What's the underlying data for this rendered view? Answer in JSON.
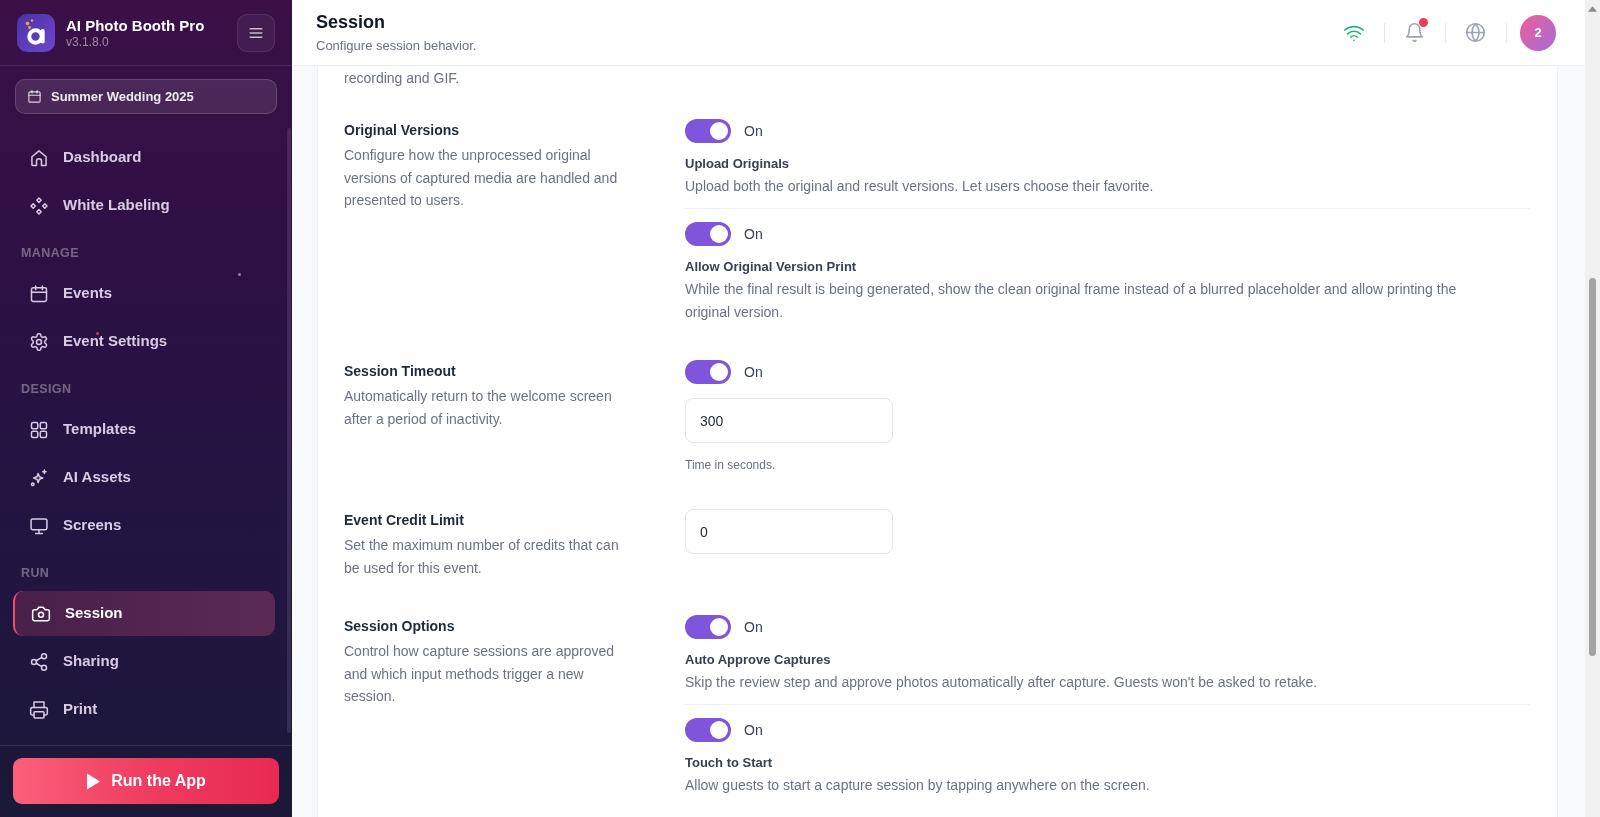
{
  "sidebar": {
    "app_name": "AI Photo Booth Pro",
    "version": "v3.1.8.0",
    "event": "Summer Wedding 2025",
    "sections": [
      {
        "items": [
          {
            "label": "Dashboard",
            "selected": false
          },
          {
            "label": "White Labeling",
            "selected": false
          }
        ]
      },
      {
        "heading": "MANAGE",
        "items": [
          {
            "label": "Events",
            "selected": false
          },
          {
            "label": "Event Settings",
            "selected": false
          }
        ]
      },
      {
        "heading": "DESIGN",
        "items": [
          {
            "label": "Templates",
            "selected": false
          },
          {
            "label": "AI Assets",
            "selected": false
          },
          {
            "label": "Screens",
            "selected": false
          }
        ]
      },
      {
        "heading": "RUN",
        "items": [
          {
            "label": "Session",
            "selected": true
          },
          {
            "label": "Sharing",
            "selected": false
          },
          {
            "label": "Print",
            "selected": false
          }
        ]
      }
    ],
    "run_button": "Run the App"
  },
  "header": {
    "title": "Session",
    "subtitle": "Configure session behavior.",
    "online": true,
    "unread_notifications": true,
    "avatar": "2"
  },
  "settings": {
    "clipped_description": "recording and GIF.",
    "groups": [
      {
        "title": "Original Versions",
        "description": "Configure how the unprocessed original versions of captured media are handled and presented to users.",
        "options": [
          {
            "kind": "toggle",
            "on": true,
            "state_label": "On",
            "label": "Upload Originals",
            "description": "Upload both the original and result versions. Let users choose their favorite."
          },
          {
            "kind": "toggle",
            "on": true,
            "state_label": "On",
            "label": "Allow Original Version Print",
            "description": "While the final result is being generated, show the clean original frame instead of a blurred placeholder and allow printing the original version."
          }
        ]
      },
      {
        "title": "Session Timeout",
        "description": "Automatically return to the welcome screen after a period of inactivity.",
        "options": [
          {
            "kind": "toggle",
            "on": true,
            "state_label": "On"
          },
          {
            "kind": "input",
            "value": "300",
            "hint": "Time in seconds."
          }
        ]
      },
      {
        "title": "Event Credit Limit",
        "description": "Set the maximum number of credits that can be used for this event.",
        "options": [
          {
            "kind": "input",
            "value": "0"
          }
        ]
      },
      {
        "title": "Session Options",
        "description": "Control how capture sessions are approved and which input methods trigger a new session.",
        "options": [
          {
            "kind": "toggle",
            "on": true,
            "state_label": "On",
            "label": "Auto Approve Captures",
            "description": "Skip the review step and approve photos automatically after capture. Guests won't be asked to retake."
          },
          {
            "kind": "toggle",
            "on": true,
            "state_label": "On",
            "label": "Touch to Start",
            "description": "Allow guests to start a capture session by tapping anywhere on the screen."
          }
        ]
      }
    ]
  }
}
